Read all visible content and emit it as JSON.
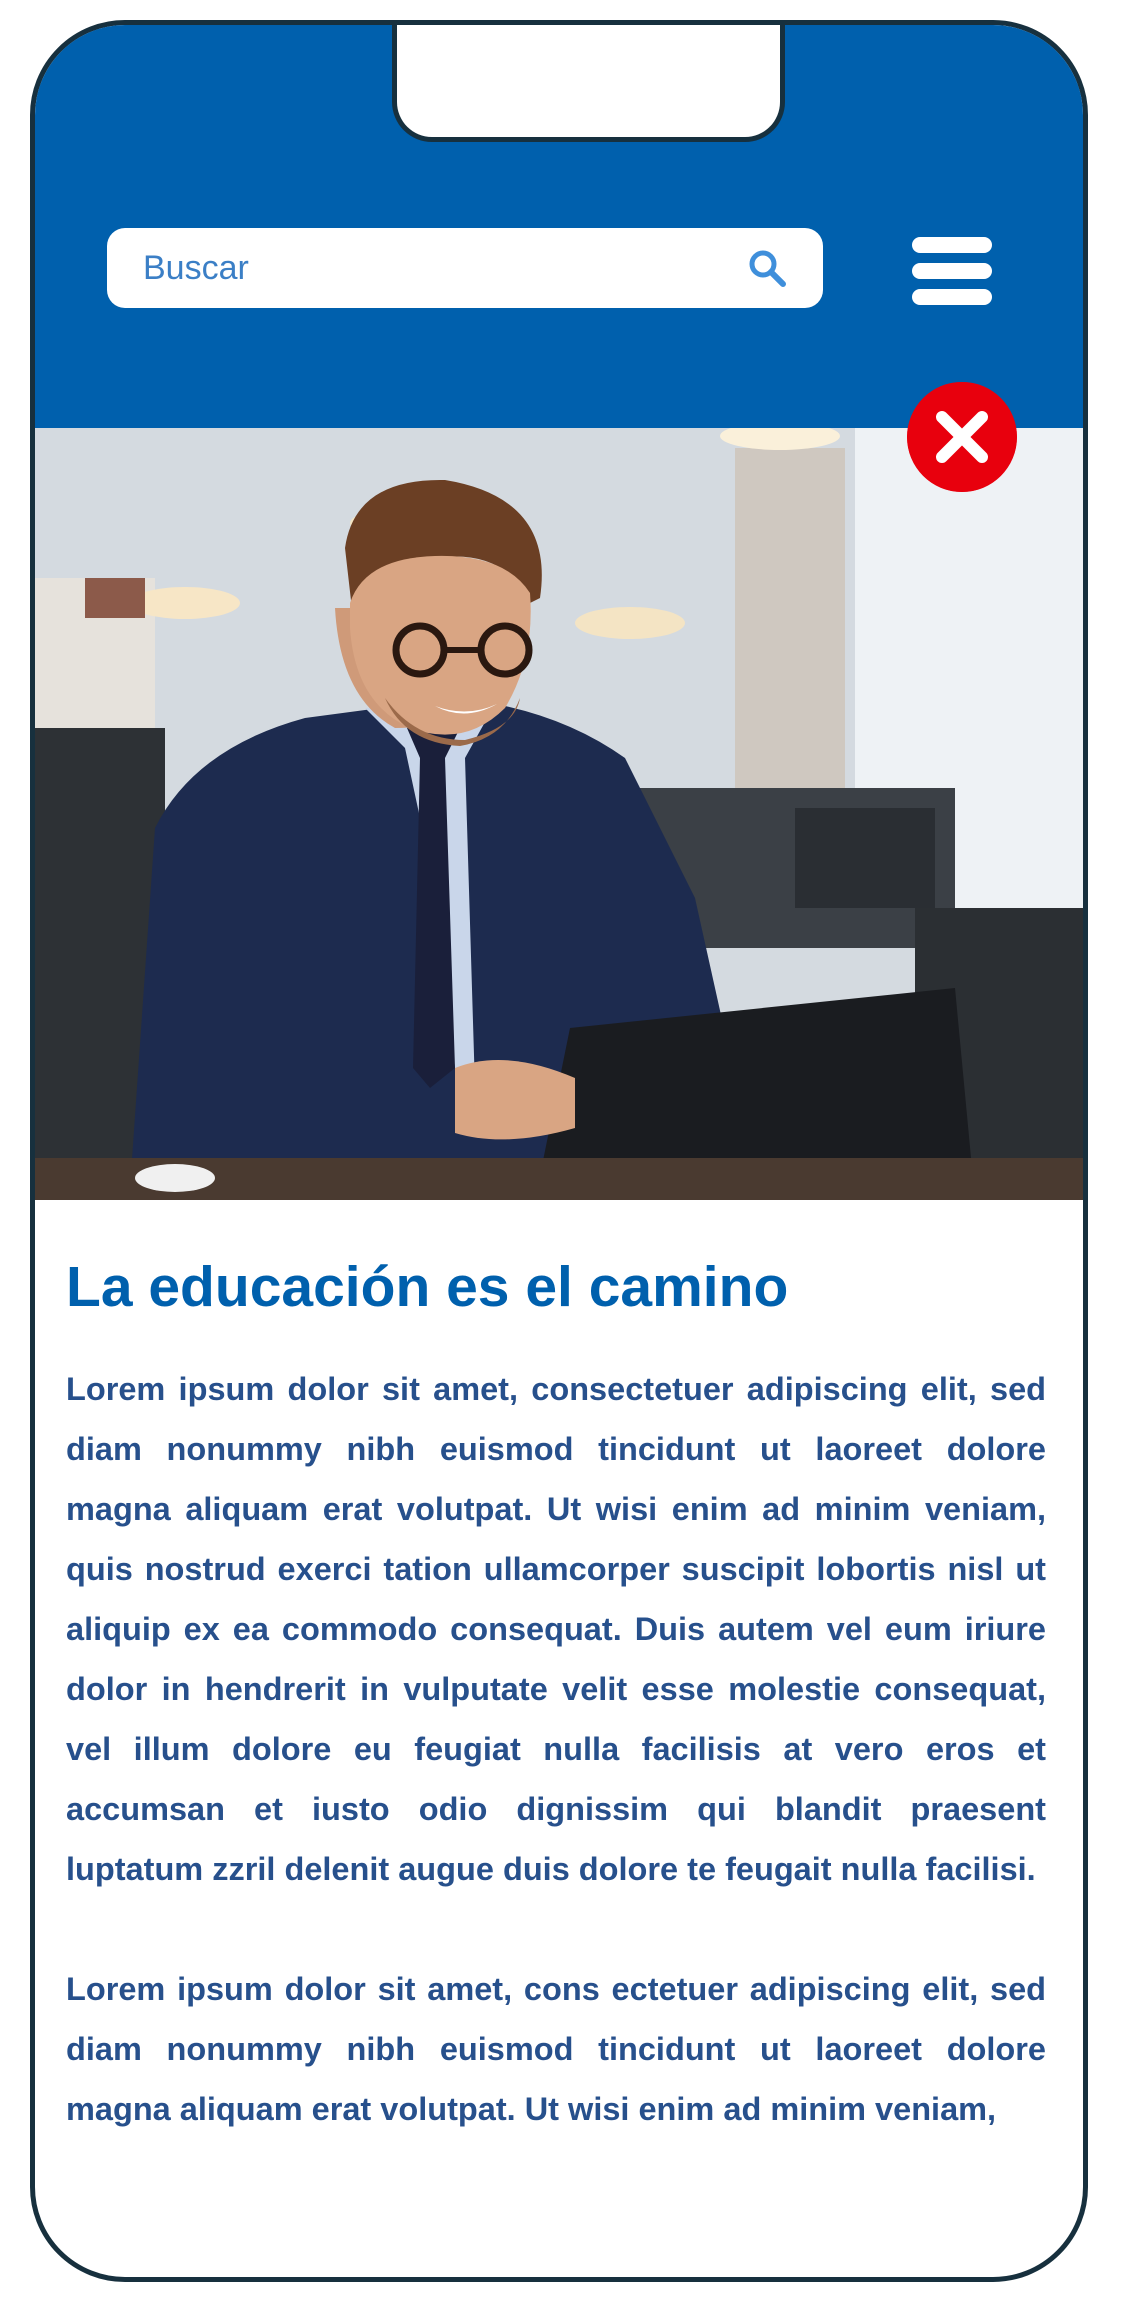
{
  "header": {
    "search": {
      "placeholder": "Buscar",
      "icon": "search-icon"
    },
    "menu_icon": "menu-icon"
  },
  "hero": {
    "image": "smiling man in suit with glasses working on laptop in office",
    "close_icon": "close-icon"
  },
  "article": {
    "title": "La educación es el camino",
    "paragraphs": [
      "Lorem ipsum dolor sit amet, consectetuer adipiscing elit, sed diam nonummy nibh euismod tincidunt ut laoreet dolore magna aliquam erat volutpat. Ut wisi enim ad minim veniam, quis nostrud exerci tation ullamcorper suscipit lobortis nisl ut aliquip ex ea commodo consequat. Duis autem vel eum iriure dolor in hendrerit in vulputate velit esse molestie consequat, vel illum dolore eu feugiat nulla facilisis at vero eros et accumsan et iusto odio dignissim qui blandit praesent luptatum zzril delenit augue duis dolore te feugait nulla facilisi.",
      "Lorem ipsum dolor sit amet, cons ectetuer adipiscing elit, sed diam nonummy nibh euismod tincidunt ut laoreet dolore magna aliquam erat volutpat. Ut wisi enim ad minim veniam,"
    ]
  },
  "colors": {
    "brand_blue": "#0060ad",
    "text_blue": "#27508c",
    "close_red": "#e8000d",
    "frame": "#17303e"
  }
}
